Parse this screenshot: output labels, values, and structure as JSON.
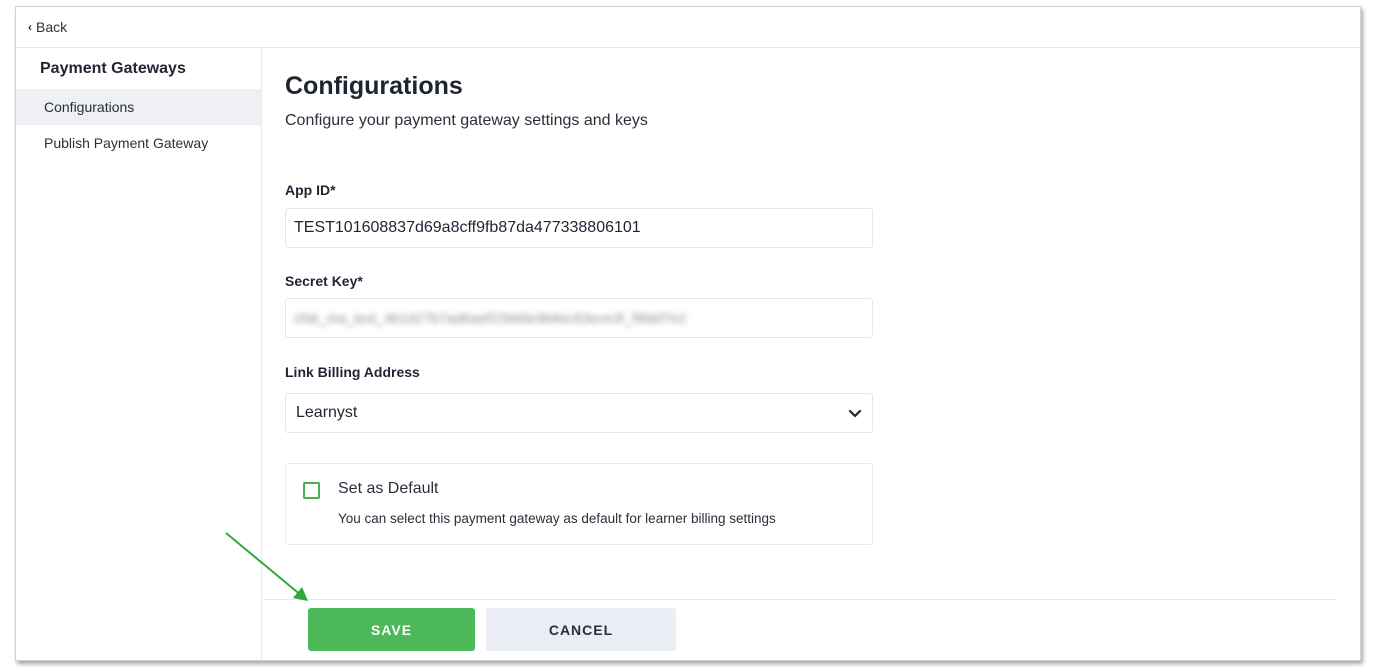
{
  "nav": {
    "back_label": "Back"
  },
  "sidebar": {
    "title": "Payment Gateways",
    "items": [
      {
        "label": "Configurations",
        "active": true
      },
      {
        "label": "Publish Payment Gateway",
        "active": false
      }
    ]
  },
  "main": {
    "title": "Configurations",
    "subtitle": "Configure your payment gateway settings and keys",
    "app_id": {
      "label": "App ID*",
      "value": "TEST101608837d69a8cff9fb87da477338806101"
    },
    "secret_key": {
      "label": "Secret Key*",
      "value": "cfsk_ma_test_4b1d27b7ad6aef22b68e9b8ec83ece3f_f9bbf7e2"
    },
    "billing": {
      "label": "Link Billing Address",
      "selected": "Learnyst"
    },
    "default": {
      "label": "Set as Default",
      "help": "You can select this payment gateway as default for learner billing settings",
      "checked": false
    }
  },
  "actions": {
    "save_label": "SAVE",
    "cancel_label": "CANCEL"
  },
  "colors": {
    "accent": "#4cb857",
    "annotation_arrow": "#2eaa3c"
  }
}
